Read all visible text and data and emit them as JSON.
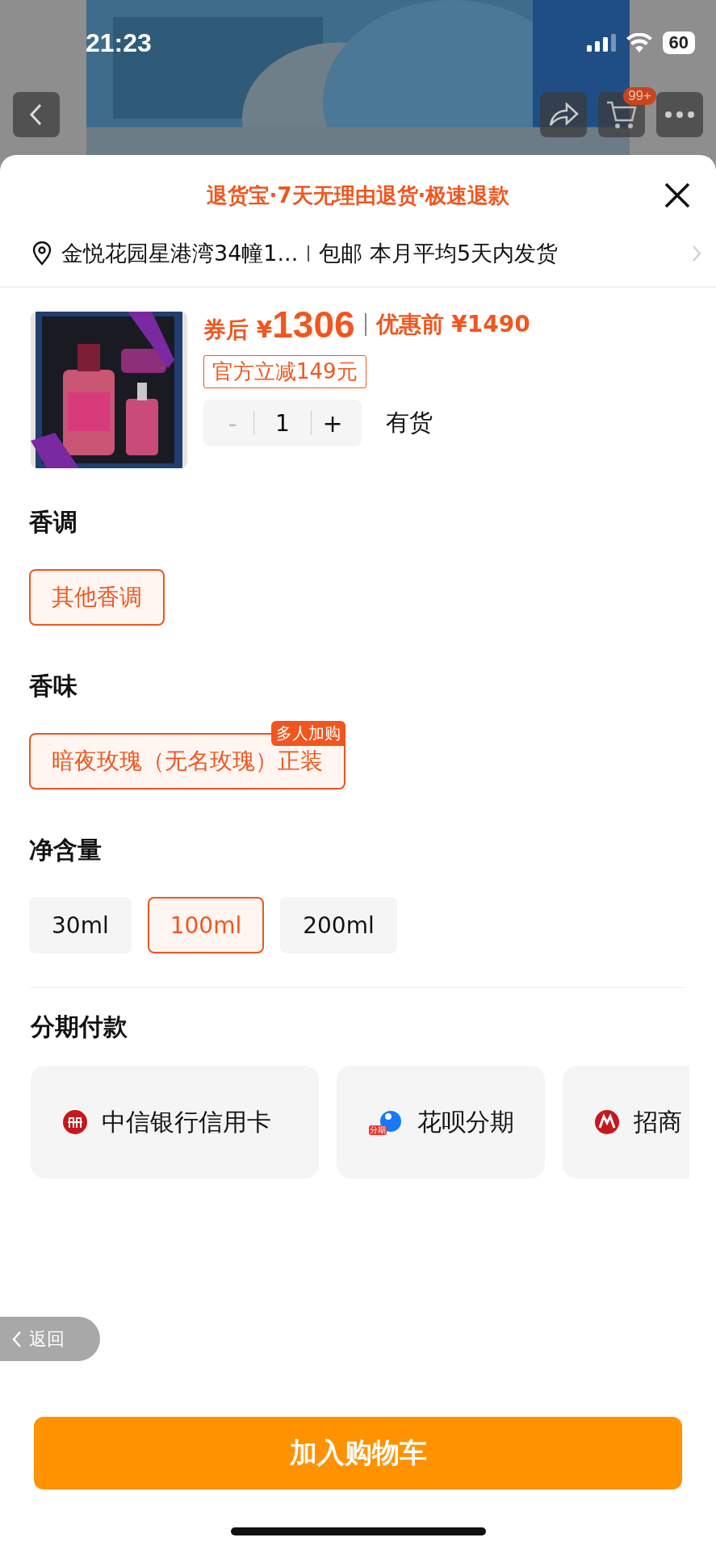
{
  "status_bar": {
    "time": "21:23",
    "battery": "60"
  },
  "top_bar": {
    "cart_badge": "99+"
  },
  "sheet": {
    "notice": "退货宝·7天无理由退货·极速退款",
    "address": "金悦花园星港湾34幢1...",
    "shipping": "包邮 本月平均5天内发货",
    "product": {
      "kind": "picture",
      "price_prefix": "券后",
      "currency": "¥",
      "price": "1306",
      "original_label": "优惠前",
      "original_price": "¥1490",
      "discount_tag": "官方立减149元",
      "quantity": "1",
      "minus": "-",
      "plus": "+",
      "stock": "有货"
    },
    "sections": [
      {
        "title": "香调",
        "options": [
          {
            "label": "其他香调",
            "selected": true
          }
        ]
      },
      {
        "title": "香味",
        "options": [
          {
            "label": "暗夜玫瑰（无名玫瑰）正装",
            "selected": true,
            "badge": "多人加购"
          }
        ]
      },
      {
        "title": "净含量",
        "options": [
          {
            "label": "30ml",
            "selected": false
          },
          {
            "label": "100ml",
            "selected": true
          },
          {
            "label": "200ml",
            "selected": false
          }
        ]
      }
    ],
    "installments": {
      "title": "分期付款",
      "cards": [
        {
          "kind": "citic",
          "label": "中信银行信用卡"
        },
        {
          "kind": "huabei",
          "label": "花呗分期",
          "icon_badge": "分期"
        },
        {
          "kind": "cmb",
          "label": "招商"
        }
      ]
    },
    "back_pill": "返回",
    "add_to_cart": "加入购物车"
  }
}
